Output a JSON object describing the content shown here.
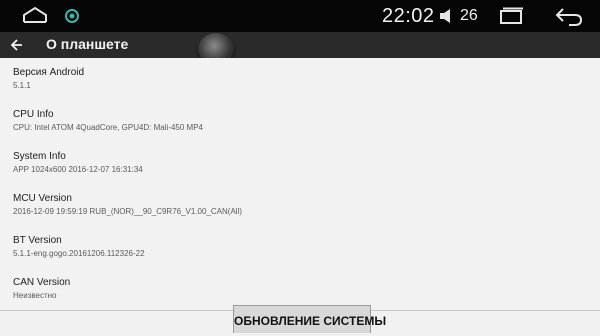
{
  "status_bar": {
    "time": "22:02",
    "volume_level": "26",
    "icons": [
      "home-icon",
      "notification-icon",
      "volume-icon",
      "recent-apps-icon",
      "back-icon"
    ]
  },
  "action_bar": {
    "title": "О планшете",
    "back_icon": "arrow-left-icon"
  },
  "items": [
    {
      "title": "Версия Android",
      "value": "5.1.1"
    },
    {
      "title": "CPU Info",
      "value": "CPU: Intel ATOM 4QuadCore, GPU4D: Mali-450 MP4"
    },
    {
      "title": "System Info",
      "value": "APP 1024x600 2016-12-07 16:31:34"
    },
    {
      "title": "MCU Version",
      "value": "2016-12-09 19:59:19 RUB_(NOR)__90_C9R76_V1.00_CAN(All)"
    },
    {
      "title": "BT Version",
      "value": "5.1.1-eng.gogo.20161206.112326-22"
    },
    {
      "title": "CAN Version",
      "value": "Неизвестно"
    }
  ],
  "update_button": {
    "label": "ОБНОВЛЕНИЕ СИСТЕМЫ"
  },
  "colors": {
    "statusbar": "#050505",
    "actionbar": "#2a2a2a",
    "background": "#f1f1f1",
    "accent": "#39b8b0"
  }
}
